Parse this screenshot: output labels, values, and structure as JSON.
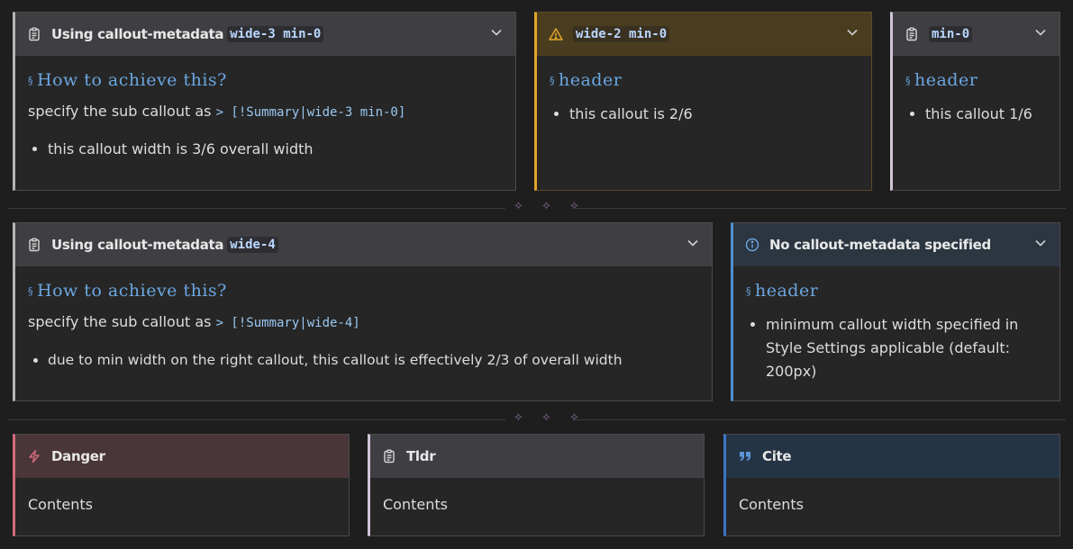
{
  "row1": {
    "c1": {
      "title_prefix": "Using callout-metadata",
      "title_code": "wide-3 min-0",
      "heading": "How to achieve this?",
      "desc_prefix": "specify the sub callout as",
      "desc_code": "> [!Summary|wide-3 min-0]",
      "bullet": "this callout width is 3/6 overall width"
    },
    "c2": {
      "title_code": "wide-2 min-0",
      "heading": "header",
      "bullet": "this callout is 2/6"
    },
    "c3": {
      "title_code": "min-0",
      "heading": "header",
      "bullet": "this callout 1/6"
    }
  },
  "row2": {
    "c1": {
      "title_prefix": "Using callout-metadata",
      "title_code": "wide-4",
      "heading": "How to achieve this?",
      "desc_prefix": "specify the sub callout as",
      "desc_code": "> [!Summary|wide-4]",
      "bullet": "due to min width on the right callout, this callout is effectively 2/3 of overall width"
    },
    "c2": {
      "title": "No callout-metadata specified",
      "heading": "header",
      "bullet": "minimum callout width specified in Style Settings applicable (default: 200px)"
    }
  },
  "row3": {
    "danger": {
      "title": "Danger",
      "contents": "Contents"
    },
    "tldr": {
      "title": "Tldr",
      "contents": "Contents"
    },
    "cite": {
      "title": "Cite",
      "contents": "Contents"
    }
  },
  "separator_glyphs": "✧ ✧ ✧",
  "heading_marker": "§",
  "icons": {
    "summary": "clipboard-icon",
    "warning": "warning-triangle-icon",
    "info": "info-circle-icon",
    "danger": "lightning-icon",
    "cite": "quote-icon",
    "fold": "chevron-down-icon"
  },
  "colors": {
    "background": "#1e1e1e",
    "callout_bg": "#262626",
    "summary_title_bg": "#3f3e42",
    "warning_title_bg": "#4a3d1f",
    "warning_accent": "#e0a52a",
    "info_title_bg": "#2c3641",
    "info_accent": "#4f8fd2",
    "danger_title_bg": "#4a3538",
    "danger_accent": "#d36b7c",
    "tldr_accent": "#cfc4d8",
    "cite_title_bg": "#253444",
    "cite_accent": "#3b75c4",
    "heading_color": "#6aa6e0"
  }
}
